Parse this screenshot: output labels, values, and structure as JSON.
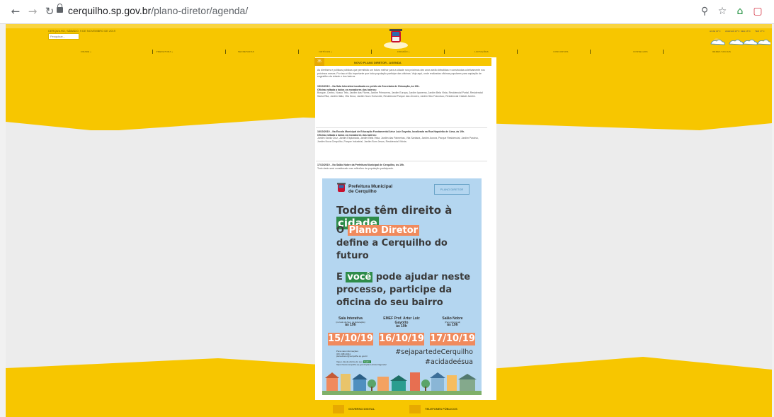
{
  "browser": {
    "url_host": "cerquilho.sp.gov.br",
    "url_path": "/plano-diretor/agenda/",
    "icons": [
      "back-icon",
      "forward-icon",
      "reload-icon",
      "lock-icon",
      "zoom-icon",
      "star-icon",
      "extension-icon",
      "pocket-icon"
    ]
  },
  "header": {
    "date_text": "CERQUILHO, SÁBADO, 9 DE NOVEMBRO DE 2019",
    "search_placeholder": "Pesquisar...",
    "weather": [
      "HOJE 13°C",
      "AMANHÃ 15°C",
      "SEG 16°C",
      "TER 17°C"
    ]
  },
  "menu": [
    "CIDADE »",
    "PREFEITURA »",
    "SECRETARIAS",
    "NOTÍCIAS »",
    "CIDADÃO »",
    "LICITAÇÕES",
    "CONCURSOS",
    "CONSELHOS",
    "REDES SOCIAIS"
  ],
  "article": {
    "tab_number": "35",
    "title": "NOVO PLANO DIRETOR - AGENDA",
    "intro": "As diretrizes e políticas públicas que permitirão um futuro melhor para a cidade nos próximos dez anos serão debatidas e construídas coletivamente nos próximos meses. Por isso é tão importante que toda população participe das oficinas. Veja aqui, onde realizadas oficinas populares para captação de sugestões da cidade e dos bairros.",
    "blocks": [
      {
        "date_line": "15/10/2019 – Na Sala Interativa localizada no prédio da Secretaria de Educação, às 19h.",
        "heading": "Oficina voltada a todos os moradores dos bairros:",
        "body": "Bosque, Centro, Nosso Teto, Jardim das Flores, Jardim Primavera, Jardim Europa, Jardim Ipanema, Jardim Bela Vista, Residencial Portal, Residencial Santa Rita, Jardim Itália, Vila Nova, Jardim Novo Horizonte, Residencial Parque das Árvores, Jardim São Francisco, Residencial Cidade Jardim."
      },
      {
        "date_line": "16/10/2019 – Na Escola Municipal de Educação Fundamental Artur Luiz Gayotto, localizada na Rua Napoleão de Lima, às 19h.",
        "heading": "Oficina voltada a todos os moradores dos bairros:",
        "body": "Jardim Santa Cruz, Jardim Esplanada, Jardim Bela Vista, Jardim das Palmeiras, Vila Santana, Jardim Aurora, Parque Residencial, Jardim Paraíso, Jardim Nova Cerquilho, Parque Industrial, Jardim Bom Jesus, Residencial Vitória."
      },
      {
        "date_line": "17/10/2019 – No Salão Nobre da Prefeitura Municipal de Cerquilho, às 19h.",
        "heading": "Todo dado será considerado nas reflexões da população participante.",
        "body": ""
      }
    ]
  },
  "poster": {
    "logo_text_1": "Prefeitura Municipal",
    "logo_text_2": "de Cerquilho",
    "plano_badge": "PLANO DIRETOR",
    "line1_pre": "Todos têm direito à ",
    "line1_hl": "cidade",
    "line2_pre": "O ",
    "line2_hl": "Plano Diretor",
    "line3": "define a Cerquilho do",
    "line4": "futuro",
    "line5_pre": "E ",
    "line5_hl": "você",
    "line5_post": " pode ajudar neste",
    "line6": "processo, participe da",
    "line7": "oficina do seu bairro",
    "venues": [
      {
        "name": "Sala Interativa",
        "sub": "(no lado da Sec. de Educação)",
        "time": "às 19h",
        "date": "15/10/19"
      },
      {
        "name": "EMEF Prof. Artur Luiz Gayotto",
        "sub": "",
        "time": "às 19h",
        "date": "16/10/19"
      },
      {
        "name": "Salão Nobre",
        "sub": "(Paço Municipal)",
        "time": "às 19h",
        "date": "17/10/19"
      }
    ],
    "info_1": "Para mais informações:",
    "info_2": "(15) 3384-9111",
    "info_3": "planodiretor@cerquilho.sp.gov.br",
    "info_4": "Veja o dia da oficina do seu",
    "info_4_hl": "bairro",
    "info_5": "https://www.cerquilho.sp.gov.br/plano-diretor/agenda/",
    "hashtag_1": "#sejapartedeCerquilho",
    "hashtag_2": "#acidadeésua"
  },
  "footer": {
    "btn1": "GOVERNO DIGITAL",
    "btn2": "TELEFONES PÚBLICOS"
  },
  "colors": {
    "brand_yellow": "#f7c600",
    "orange": "#f08a5d",
    "green": "#2e8c4a",
    "poster_blue": "#b4d6f0"
  }
}
